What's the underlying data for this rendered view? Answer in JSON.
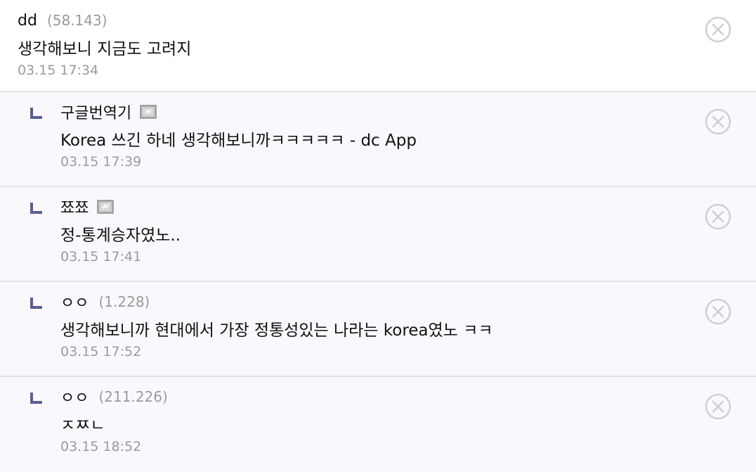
{
  "comments": [
    {
      "name": "dd",
      "ip": "(58.143)",
      "text": "생각해보니 지금도 고려지",
      "date": "03.15 17:34"
    },
    {
      "name": "구글번역기",
      "text": "Korea 쓰긴 하네 생각해보니까ㅋㅋㅋㅋㅋ - dc App",
      "date": "03.15 17:39",
      "badge": "gallog-badge-icon"
    },
    {
      "name": "쬬쬬",
      "text": "정-통계승자였노..",
      "date": "03.15 17:41",
      "badge": "gallog-badge-icon"
    },
    {
      "name": "ㅇㅇ",
      "ip": "(1.228)",
      "text": "생각해보니까 현대에서 가장 정통성있는 나라는 korea였노 ㅋㅋ",
      "date": "03.15 17:52"
    },
    {
      "name": "ㅇㅇ",
      "ip": "(211.226)",
      "text": "ㅈㅉㄴ",
      "date": "03.15 18:52"
    }
  ],
  "icons": {
    "reply": "reply-arrow-icon",
    "delete": "delete-circle-x-icon"
  },
  "colors": {
    "reply_mark": "#5a5f8f",
    "reply_bg": "#fbf8fd",
    "divider": "#e2e2e6",
    "meta": "#9a9a9a"
  }
}
